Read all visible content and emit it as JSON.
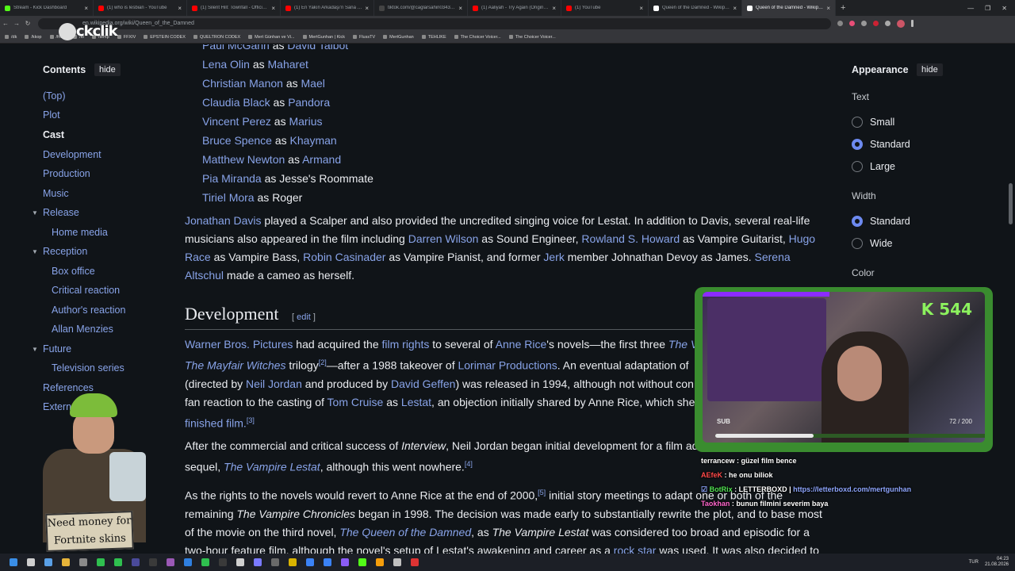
{
  "browser": {
    "tabs": [
      {
        "title": "Stream - Kick Dashboard",
        "color": "#53fc18"
      },
      {
        "title": "(1) who is lesbian - YouTube",
        "color": "#ff0000"
      },
      {
        "title": "(1) Silent Hill: Townfall - Official G...",
        "color": "#ff0000"
      },
      {
        "title": "(1) En Yakın Arkadaşı'n Sana Açıkç",
        "color": "#ff0000"
      },
      {
        "title": "tiktok.com/@caglarsahin0343/vide",
        "color": "#444444"
      },
      {
        "title": "(1) Aaliyah - Try Again (Original Ve",
        "color": "#ff0000"
      },
      {
        "title": "(1) YouTube",
        "color": "#ff0000"
      },
      {
        "title": "Queen of the Damned - Wikipedia",
        "color": "#ffffff"
      },
      {
        "title": "Queen of the Damned - Wikipedia",
        "color": "#ffffff"
      }
    ],
    "url": "en.wikipedia.org/wiki/Queen_of_the_Damned",
    "bookmarks": [
      "/dk",
      "/kkop",
      "/fnsk",
      "/lo",
      "/temp",
      "FFXIV",
      "EPSTEIN CODEX",
      "QUELTRON CODEX",
      "Mert Günhan ve Vi...",
      "MertGunhan | Kick",
      "FlussTV",
      "MertGunhan",
      "TEHLIKE",
      "The Choicer Voicer...",
      "The Choicer Voicer..."
    ],
    "overlay_logo": "ckclik"
  },
  "toc": {
    "title": "Contents",
    "hide_label": "hide",
    "items": [
      {
        "label": "(Top)"
      },
      {
        "label": "Plot"
      },
      {
        "label": "Cast"
      },
      {
        "label": "Development"
      },
      {
        "label": "Production"
      },
      {
        "label": "Music"
      },
      {
        "label": "Release"
      },
      {
        "label": "Home media"
      },
      {
        "label": "Reception"
      },
      {
        "label": "Box office"
      },
      {
        "label": "Critical reaction"
      },
      {
        "label": "Author's reaction"
      },
      {
        "label": "Allan Menzies"
      },
      {
        "label": "Future"
      },
      {
        "label": "Television series"
      },
      {
        "label": "References"
      },
      {
        "label": "External links"
      }
    ]
  },
  "cast": [
    {
      "actor": "Paul McGann",
      "as": "as",
      "role": "David Talbot",
      "role_link": true
    },
    {
      "actor": "Lena Olin",
      "as": "as",
      "role": "Maharet",
      "role_link": true
    },
    {
      "actor": "Christian Manon",
      "as": "as",
      "role": "Mael",
      "role_link": true
    },
    {
      "actor": "Claudia Black",
      "as": "as",
      "role": "Pandora",
      "role_link": true
    },
    {
      "actor": "Vincent Perez",
      "as": "as",
      "role": "Marius",
      "role_link": true
    },
    {
      "actor": "Bruce Spence",
      "as": "as",
      "role": "Khayman",
      "role_link": true
    },
    {
      "actor": "Matthew Newton",
      "as": "as",
      "role": "Armand",
      "role_link": true
    },
    {
      "actor": "Pia Miranda",
      "as": "as",
      "role": "Jesse's Roommate",
      "role_link": false
    },
    {
      "actor": "Tiriel Mora",
      "as": "as",
      "role": "Roger",
      "role_link": false
    }
  ],
  "cast_paragraph": {
    "l1a": "Jonathan Davis",
    "l1b": " played a Scalper and also provided the uncredited singing voice for Lestat. In addition to Davis, several real-life",
    "l2a": "musicians also appeared in the film including ",
    "l2b": "Darren Wilson",
    "l2c": " as Sound Engineer, ",
    "l2d": "Rowland S. Howard",
    "l2e": " as Vampire Guitarist, ",
    "l2f": "Hugo",
    "l3a": "Race",
    "l3b": " as Vampire Bass, ",
    "l3c": "Robin Casinader",
    "l3d": " as Vampire Pianist, and former ",
    "l3e": "Jerk",
    "l3f": " member Johnathan Devoy as James. ",
    "l3g": "Serena",
    "l4a": "Altschul",
    "l4b": " made a cameo as herself."
  },
  "development": {
    "heading": "Development",
    "edit_open": "[ ",
    "edit_label": "edit",
    "edit_close": " ]",
    "p1": {
      "l1a": "Warner Bros. Pictures",
      "l1b": " had acquired the ",
      "l1c": "film rights",
      "l1d": " to several of ",
      "l1e": "Anne Rice",
      "l1f": "'s novels—the first three ",
      "l1g": "The V",
      "l2a": "The Mayfair Witches",
      "l2b": " trilogy",
      "l2c": "[2]",
      "l2d": "—after a 1988 takeover of ",
      "l2e": "Lorimar Productions",
      "l2f": ". An eventual adaptation of",
      "l3a": "(directed by ",
      "l3b": "Neil Jordan",
      "l3c": " and produced by ",
      "l3d": "David Geffen",
      "l3e": ") was released in 1994, although not without con",
      "l4a": "fan reaction to the casting of ",
      "l4b": "Tom Cruise",
      "l4c": " as ",
      "l4d": "Lestat",
      "l4e": ", an objection initially shared by Anne Rice, which she",
      "l5a": "finished film.",
      "l5b": "[3]"
    },
    "p2": {
      "l1a": "After the commercial and critical success of ",
      "l1b": "Interview",
      "l1c": ", Neil Jordan began initial development for a film ad",
      "l2a": "sequel, ",
      "l2b": "The Vampire Lestat",
      "l2c": ", although this went nowhere.",
      "l2d": "[4]"
    },
    "p3": {
      "l1a": "As the rights to the novels would revert to Anne Rice at the end of 2000,",
      "l1b": "[5]",
      "l1c": " initial story meetings to adapt one or both of the",
      "l2a": "remaining ",
      "l2b": "The Vampire Chronicles",
      "l2c": " began in 1998. The decision was made early to substantially rewrite the plot, and to base most",
      "l3a": "of the movie on the third novel, ",
      "l3b": "The Queen of the Damned",
      "l3c": ", as ",
      "l3d": "The Vampire Lestat",
      "l3e": " was considered too broad and episodic for a",
      "l4a": "two-hour feature film, although the novel's setup of Lestat's awakening and career as a ",
      "l4b": "rock star",
      "l4c": " was used. It was also decided to"
    }
  },
  "appearance": {
    "title": "Appearance",
    "hide_label": "hide",
    "text_label": "Text",
    "text_options": [
      {
        "label": "Small",
        "selected": false
      },
      {
        "label": "Standard",
        "selected": true
      },
      {
        "label": "Large",
        "selected": false
      }
    ],
    "width_label": "Width",
    "width_options": [
      {
        "label": "Standard",
        "selected": true
      },
      {
        "label": "Wide",
        "selected": false
      }
    ],
    "color_label": "Color"
  },
  "stream": {
    "counter": "K 544",
    "sub_label": "SUB",
    "goal_text": "72 / 200",
    "goal_progress": 0.36,
    "chat": [
      {
        "user": "terrancew",
        "user_color": "#ffffff",
        "sep": " : ",
        "msg": "güzel film bence"
      },
      {
        "user": "AEfeK",
        "user_color": "#ff4a4a",
        "sep": " : ",
        "msg": "he onu biliok"
      },
      {
        "user": "BotRix",
        "user_color": "#52e352",
        "sep": " : ",
        "msg": "LETTERBOXD | ",
        "link": "https://letterboxd.com/mertgunhan"
      },
      {
        "user": "Taokhan",
        "user_color": "#ff66cc",
        "sep": " : ",
        "msg": "bunun filmini severim baya"
      }
    ],
    "sign_line1": "Need money for",
    "sign_line2": "Fortnite skins"
  },
  "taskbar": {
    "lang": "TUR",
    "time": "04:23",
    "date": "21.08.2026"
  }
}
